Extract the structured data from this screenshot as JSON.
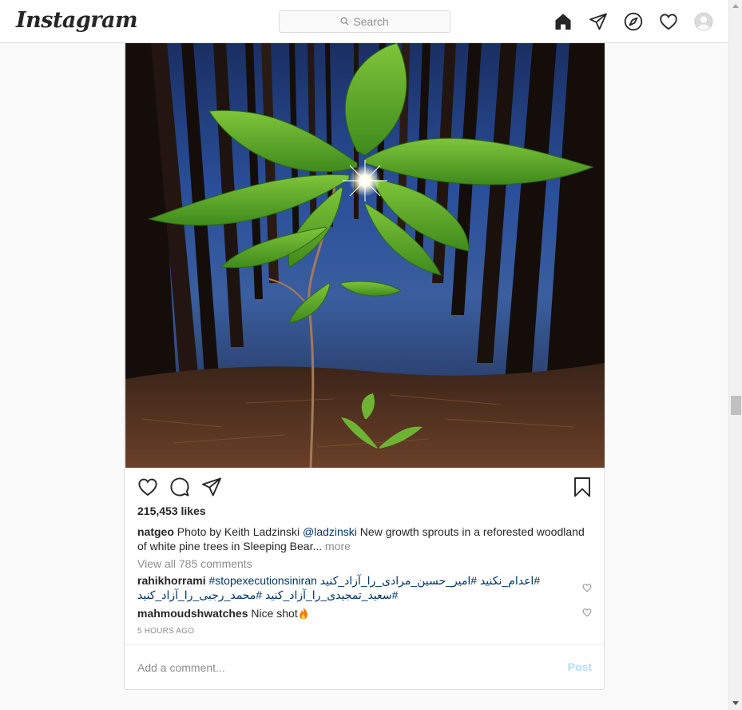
{
  "header": {
    "logo": "Instagram",
    "search_placeholder": "Search"
  },
  "post": {
    "image_alt": "Young chestnut sapling leaves with sun star, pine forest",
    "likes": "215,453 likes",
    "caption": {
      "user": "natgeo",
      "text1": " Photo by Keith Ladzinski ",
      "mention": "@ladzinski",
      "text2": " New growth sprouts in a reforested woodland of white pine trees in Sleeping Bear...",
      "more": " more"
    },
    "view_all": "View all 785 comments",
    "comments": [
      {
        "user": "rahikhorrami",
        "hashtag": "#stopexecutionsiniran",
        "rtl_text": "#اعدام_نکنید #امیر_حسین_مرادی_را_آزاد_کنید #سعید_تمجیدی_را_آزاد_کنید #محمد_رجبی_را_آزاد_کنید"
      },
      {
        "user": "mahmoudshwatches",
        "text": "Nice shot"
      }
    ],
    "timestamp": "5 HOURS AGO",
    "add_comment_placeholder": "Add a comment...",
    "post_label": "Post"
  },
  "colors": {
    "link": "#003569",
    "muted": "#8e8e8e",
    "post_disabled": "#b3dbff",
    "border": "#dbdbdb"
  },
  "icons": [
    "search-icon",
    "home-icon",
    "direct-icon",
    "explore-icon",
    "activity-heart-icon",
    "avatar",
    "like-icon",
    "comment-icon",
    "share-icon",
    "save-icon",
    "comment-like-icon",
    "fire-emoji"
  ]
}
